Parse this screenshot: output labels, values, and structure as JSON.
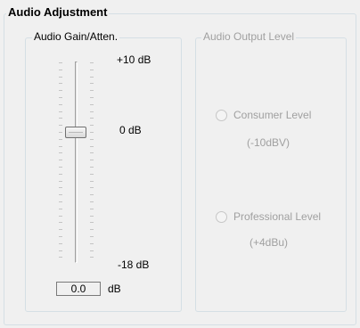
{
  "audio_adjustment": {
    "title": "Audio Adjustment",
    "gain": {
      "title": "Audio Gain/Atten.",
      "max_label": "+10 dB",
      "mid_label": "0 dB",
      "min_label": "-18 dB",
      "value": "0.0",
      "unit": "dB",
      "slider_range_db": [
        -18,
        10
      ],
      "slider_value_db": 0
    },
    "output_level": {
      "title": "Audio Output Level",
      "enabled": false,
      "options": [
        {
          "label": "Consumer Level",
          "sublabel": "(-10dBV)",
          "selected": false
        },
        {
          "label": "Professional Level",
          "sublabel": "(+4dBu)",
          "selected": false
        }
      ]
    }
  },
  "colors": {
    "background": "#f0f0f0",
    "group_border": "#d5dfe5",
    "disabled_text": "#a0a0a0"
  }
}
